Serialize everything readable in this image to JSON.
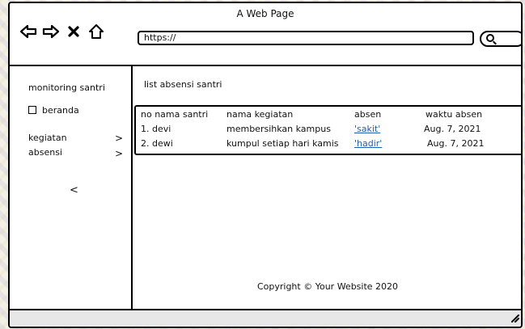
{
  "window": {
    "title": "A Web Page"
  },
  "browser": {
    "url": "https://"
  },
  "sidebar": {
    "title": "monitoring santri",
    "items": [
      {
        "label": "beranda",
        "type": "checkbox"
      },
      {
        "label": "kegiatan",
        "chevron": ">"
      },
      {
        "label": "absensi",
        "chevron": ">"
      }
    ],
    "collapse_label": "<"
  },
  "main": {
    "list_title": "list absensi santri",
    "columns": [
      "no nama santri",
      "nama kegiatan",
      "absen",
      "waktu absen"
    ],
    "rows": [
      {
        "name": "1. devi",
        "activity": "membersihkan kampus",
        "status": "'sakit'",
        "time": "Aug. 7, 2021"
      },
      {
        "name": "2. dewi",
        "activity": "kumpul setiap hari kamis",
        "status": "'hadir'",
        "time": "Aug. 7, 2021"
      }
    ]
  },
  "footer": {
    "copyright": "Copyright © Your Website 2020"
  },
  "colors": {
    "link": "#1f5fb0",
    "status_bar": "#e7e7e7"
  }
}
